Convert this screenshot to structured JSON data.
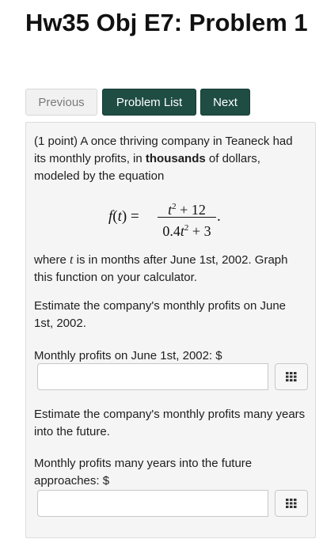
{
  "title": "Hw35 Obj E7: Problem 1",
  "nav": {
    "previous": "Previous",
    "problem_list": "Problem List",
    "next": "Next"
  },
  "problem": {
    "intro_a": "(1 point) A once thriving company in Teaneck had its monthly profits, in ",
    "intro_bold": "thousands",
    "intro_b": " of dollars, modeled by the equation",
    "where_a": "where ",
    "where_var": "t",
    "where_b": " is in months after June 1st, 2002. Graph this function on your calculator.",
    "estimate1": "Estimate the company's monthly profits on June 1st, 2002.",
    "label1": "Monthly profits on June 1st, 2002: $",
    "estimate2": "Estimate the company's monthly profits many years into the future.",
    "label2": "Monthly profits many years into the future approaches: $",
    "answer1_value": "",
    "answer2_value": ""
  },
  "equation": {
    "lhs_f": "f",
    "lhs_open": "(",
    "lhs_t": "t",
    "lhs_close": ") =",
    "num_t": "t",
    "num_exp": "2",
    "num_rest": " + 12",
    "den_coef": "0.4",
    "den_t": "t",
    "den_exp": "2",
    "den_rest": " + 3",
    "period": "."
  },
  "icons": {
    "keypad": "keypad-grid-icon"
  }
}
